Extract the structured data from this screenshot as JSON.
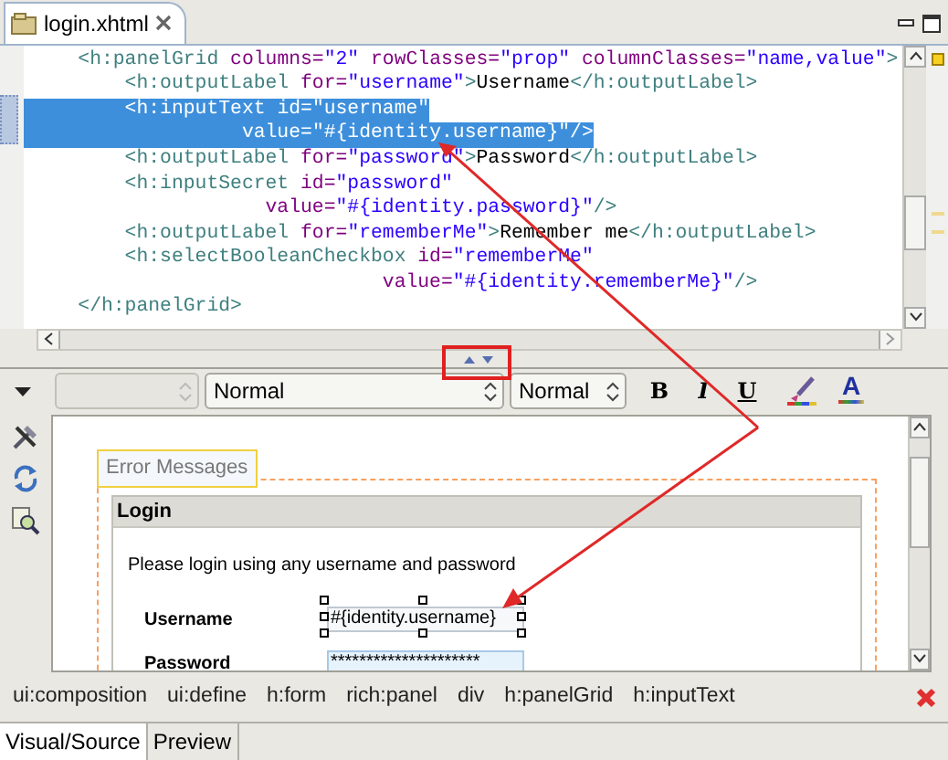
{
  "editor_tab": {
    "title": "login.xhtml",
    "selected": true
  },
  "source": {
    "lines": [
      {
        "selected": false,
        "tokens": [
          {
            "kind": "tag",
            "text": "    <h:panelGrid"
          },
          {
            "kind": "attr",
            "text": " columns="
          },
          {
            "kind": "value",
            "text": "\"2\""
          },
          {
            "kind": "attr",
            "text": " rowClasses="
          },
          {
            "kind": "value",
            "text": "\"prop\""
          },
          {
            "kind": "attr",
            "text": " columnClasses="
          },
          {
            "kind": "value",
            "text": "\"name,value\""
          },
          {
            "kind": "tag",
            "text": ">"
          }
        ]
      },
      {
        "selected": false,
        "tokens": [
          {
            "kind": "tag",
            "text": "        <h:outputLabel"
          },
          {
            "kind": "attr",
            "text": " for="
          },
          {
            "kind": "value",
            "text": "\"username\""
          },
          {
            "kind": "tag",
            "text": ">"
          },
          {
            "kind": "text",
            "text": "Username"
          },
          {
            "kind": "tag",
            "text": "</h:outputLabel>"
          }
        ]
      },
      {
        "selected": true,
        "tokens": [
          {
            "kind": "tag",
            "text": "        <h:inputText"
          },
          {
            "kind": "attr",
            "text": " id="
          },
          {
            "kind": "value",
            "text": "\"username\""
          }
        ]
      },
      {
        "selected": true,
        "tokens": [
          {
            "kind": "attr",
            "text": "                  value="
          },
          {
            "kind": "value",
            "text": "\"#{identity.username}\""
          },
          {
            "kind": "tag",
            "text": "/>"
          }
        ]
      },
      {
        "selected": false,
        "tokens": [
          {
            "kind": "tag",
            "text": "        <h:outputLabel"
          },
          {
            "kind": "attr",
            "text": " for="
          },
          {
            "kind": "value",
            "text": "\"password\""
          },
          {
            "kind": "tag",
            "text": ">"
          },
          {
            "kind": "text",
            "text": "Password"
          },
          {
            "kind": "tag",
            "text": "</h:outputLabel>"
          }
        ]
      },
      {
        "selected": false,
        "tokens": [
          {
            "kind": "tag",
            "text": "        <h:inputSecret"
          },
          {
            "kind": "attr",
            "text": " id="
          },
          {
            "kind": "value",
            "text": "\"password\""
          }
        ]
      },
      {
        "selected": false,
        "tokens": [
          {
            "kind": "attr",
            "text": "                    value="
          },
          {
            "kind": "value",
            "text": "\"#{identity.password}\""
          },
          {
            "kind": "tag",
            "text": "/>"
          }
        ]
      },
      {
        "selected": false,
        "tokens": [
          {
            "kind": "tag",
            "text": "        <h:outputLabel"
          },
          {
            "kind": "attr",
            "text": " for="
          },
          {
            "kind": "value",
            "text": "\"rememberMe\""
          },
          {
            "kind": "tag",
            "text": ">"
          },
          {
            "kind": "text",
            "text": "Remember me"
          },
          {
            "kind": "tag",
            "text": "</h:outputLabel>"
          }
        ]
      },
      {
        "selected": false,
        "tokens": [
          {
            "kind": "tag",
            "text": "        <h:selectBooleanCheckbox"
          },
          {
            "kind": "attr",
            "text": " id="
          },
          {
            "kind": "value",
            "text": "\"rememberMe\""
          }
        ]
      },
      {
        "selected": false,
        "tokens": [
          {
            "kind": "attr",
            "text": "                              value="
          },
          {
            "kind": "value",
            "text": "\"#{identity.rememberMe}\""
          },
          {
            "kind": "tag",
            "text": "/>"
          }
        ]
      },
      {
        "selected": false,
        "tokens": [
          {
            "kind": "tag",
            "text": "    </h:panelGrid>"
          }
        ]
      }
    ]
  },
  "toolbar": {
    "format_combo": {
      "value": "Normal"
    },
    "size_combo": {
      "value": "Normal"
    },
    "buttons": [
      {
        "kind": "bold",
        "label": "B"
      },
      {
        "kind": "italic",
        "label": "I"
      },
      {
        "kind": "underline",
        "label": "U"
      },
      {
        "kind": "brush"
      },
      {
        "kind": "font-color",
        "label": "A"
      }
    ]
  },
  "preview": {
    "error_tab": "Error Messages",
    "panel_title": "Login",
    "message": "Please login using any username and password",
    "fields": [
      {
        "label": "Username",
        "value": "#{identity.username}",
        "selected": true
      },
      {
        "label": "Password",
        "value": "*********************",
        "selected": false
      }
    ]
  },
  "breadcrumbs": [
    "ui:composition",
    "ui:define",
    "h:form",
    "rich:panel",
    "div",
    "h:panelGrid",
    "h:inputText"
  ],
  "bottom_tabs": [
    {
      "label": "Visual/Source",
      "selected": true
    },
    {
      "label": "Preview",
      "selected": false
    }
  ]
}
